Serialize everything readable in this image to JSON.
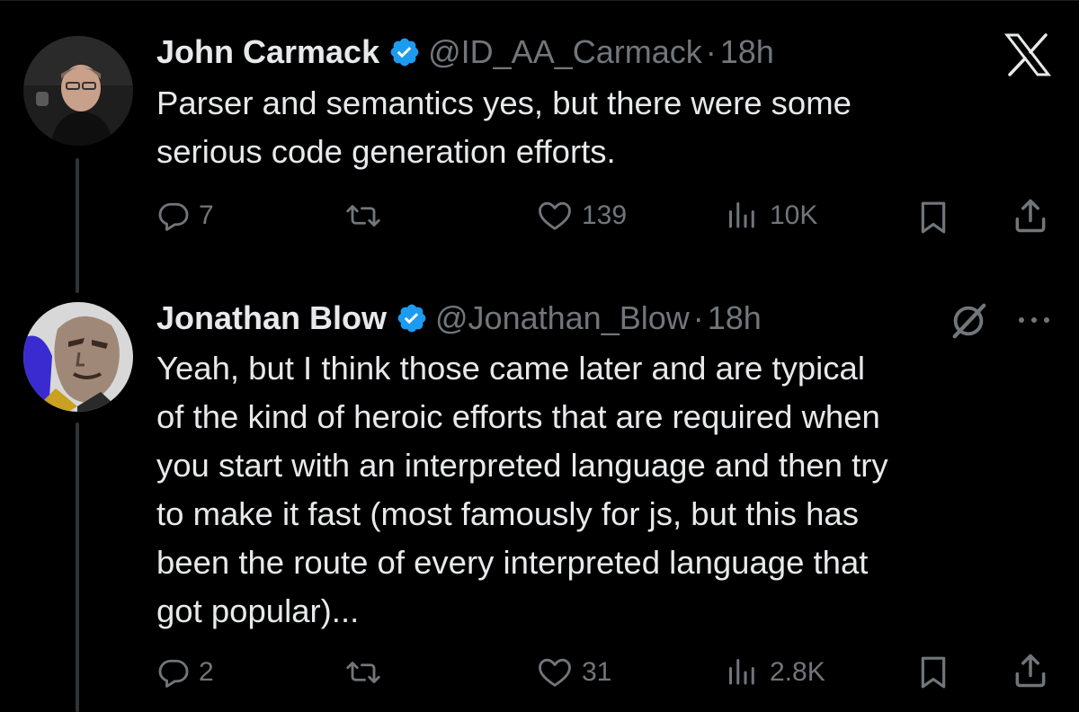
{
  "tweets": [
    {
      "author": {
        "name": "John Carmack",
        "handle": "@ID_AA_Carmack",
        "avatar": "carmack-avatar"
      },
      "separator": "·",
      "time": "18h",
      "lines": [
        "Parser and semantics yes, but there were some",
        "serious code generation efforts."
      ],
      "actions": {
        "replies": "7",
        "reposts": "",
        "likes": "139",
        "views": "10K"
      }
    },
    {
      "author": {
        "name": "Jonathan Blow",
        "handle": "@Jonathan_Blow",
        "avatar": "blow-avatar"
      },
      "separator": "·",
      "time": "18h",
      "lines": [
        "Yeah, but I think those came later and are typical",
        "of the kind of heroic efforts that are required when",
        "you start with an interpreted language and then try",
        "to make it fast (most famously for js, but this has",
        "been the route of every interpreted language that",
        "got popular)..."
      ],
      "actions": {
        "replies": "2",
        "reposts": "",
        "likes": "31",
        "views": "2.8K"
      }
    }
  ],
  "icons": {
    "brand": "x-logo-icon",
    "verified": "verified-badge-icon",
    "reply": "reply-icon",
    "repost": "repost-icon",
    "like": "heart-icon",
    "views": "views-icon",
    "bookmark": "bookmark-icon",
    "share": "share-icon",
    "grok": "grok-icon",
    "more": "more-icon"
  },
  "colors": {
    "background": "#000000",
    "text": "#e7e9ea",
    "muted": "#71767b",
    "verified": "#1d9bf0"
  }
}
